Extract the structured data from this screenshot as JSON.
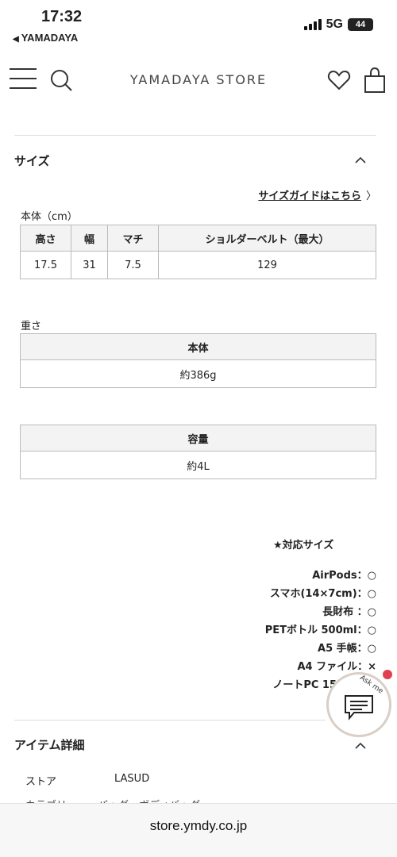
{
  "status": {
    "time": "17:32",
    "back_label": "YAMADAYA",
    "network": "5G",
    "battery": "44"
  },
  "header": {
    "brand": "YAMADAYA STORE"
  },
  "size_section": {
    "title": "サイズ",
    "guide_link": "サイズガイドはこちら",
    "body_label": "本体（cm）",
    "body_table": {
      "headers": [
        "高さ",
        "幅",
        "マチ",
        "ショルダーベルト（最大）"
      ],
      "row": [
        "17.5",
        "31",
        "7.5",
        "129"
      ]
    },
    "weight_label": "重さ",
    "weight_table": {
      "header": "本体",
      "value": "約386g"
    },
    "capacity_table": {
      "header": "容量",
      "value": "約4L"
    }
  },
  "compat": {
    "title": "★対応サイズ",
    "items": [
      "AirPods：○",
      "スマホ(14×7cm)：○",
      "長財布 ：○",
      "PETボトル 500ml：○",
      "A5 手帳：○",
      "A4 ファイル：×",
      "ノートPC 15"
    ]
  },
  "chat": {
    "label": "Ask me"
  },
  "details": {
    "title": "アイテム詳細",
    "store_key": "ストア",
    "store_value": "LASUD",
    "cut_row": "カテゴリ　　　バッグ・ボディバッグ"
  },
  "urlbar": {
    "url": "store.ymdy.co.jp"
  }
}
